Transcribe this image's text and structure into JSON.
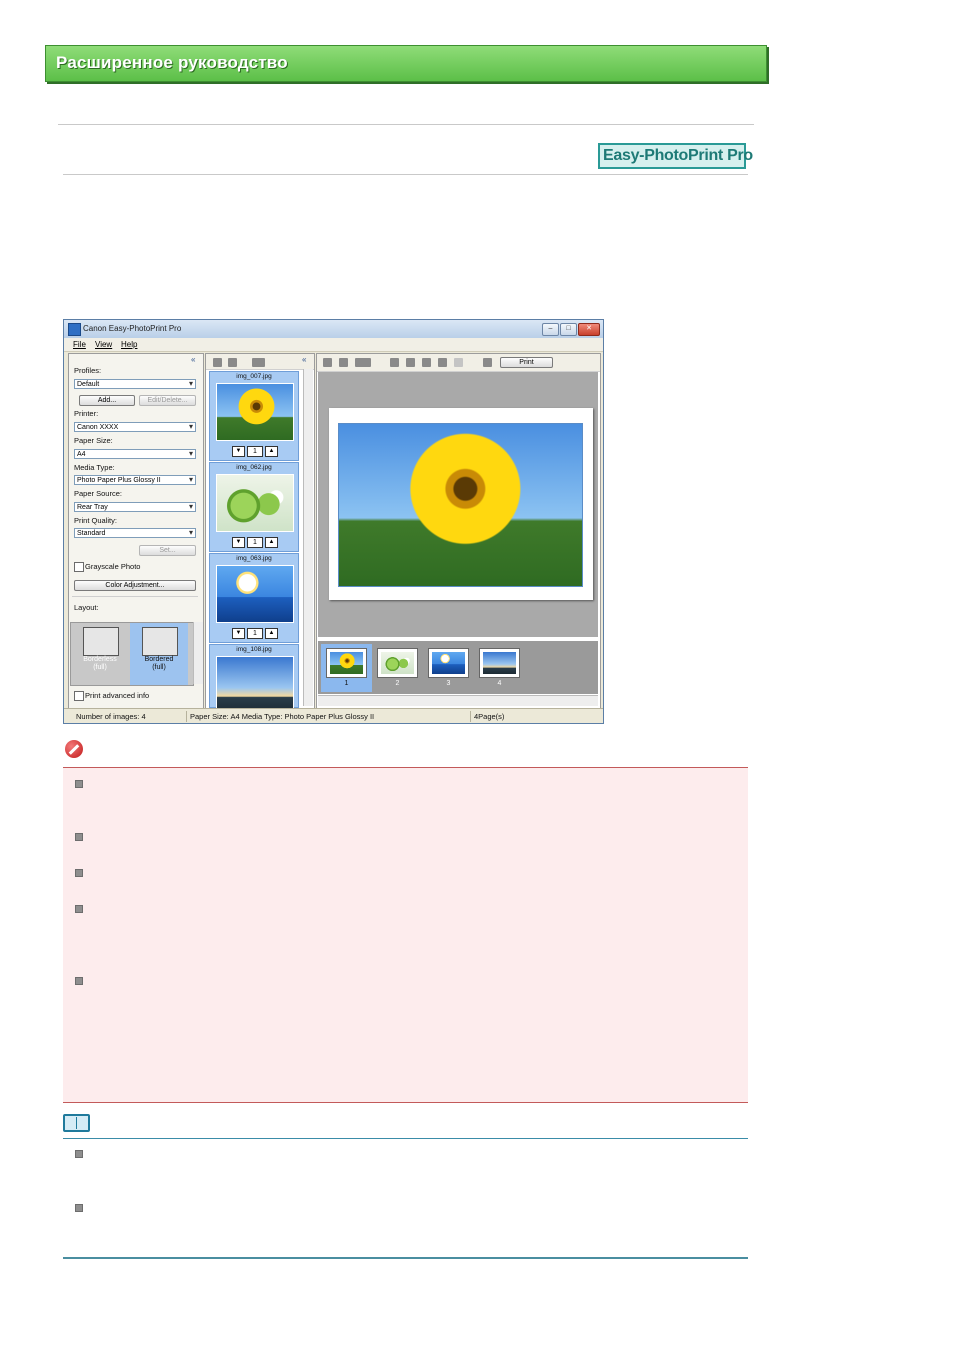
{
  "header": {
    "title": "Расширенное руководство"
  },
  "product_badge": "Easy-PhotoPrint Pro",
  "window": {
    "title": "Canon Easy-PhotoPrint Pro",
    "menu": [
      "File",
      "View",
      "Help"
    ],
    "left_panel": {
      "profiles_label": "Profiles:",
      "profiles_value": "Default",
      "add_button": "Add...",
      "edit_delete_button": "Edit/Delete...",
      "printer_label": "Printer:",
      "printer_value": "Canon XXXX",
      "paper_size_label": "Paper Size:",
      "paper_size_value": "A4",
      "media_type_label": "Media Type:",
      "media_type_value": "Photo Paper Plus Glossy II",
      "paper_source_label": "Paper Source:",
      "paper_source_value": "Rear Tray",
      "print_quality_label": "Print Quality:",
      "print_quality_value": "Standard",
      "set_button": "Set...",
      "grayscale_label": "Grayscale Photo",
      "color_adjustment_button": "Color Adjustment...",
      "layout_label": "Layout:",
      "layouts": [
        {
          "line1": "Borderless",
          "line2": "(full)"
        },
        {
          "line1": "Bordered",
          "line2": "(full)"
        }
      ],
      "print_advanced_label": "Print advanced info"
    },
    "images": [
      {
        "name": "img_007.jpg",
        "count": "1"
      },
      {
        "name": "img_062.jpg",
        "count": "1"
      },
      {
        "name": "img_063.jpg",
        "count": "1"
      },
      {
        "name": "img_108.jpg"
      }
    ],
    "print_button": "Print",
    "pages": [
      "1",
      "2",
      "3",
      "4"
    ],
    "status": {
      "images": "Number of images: 4",
      "paper": "Paper Size: A4  Media Type: Photo Paper Plus Glossy II",
      "pages": "4Page(s)"
    }
  },
  "colors": {
    "banner": "#6fcf58",
    "badge_border": "#2a9a96",
    "important_bg": "#fdeced",
    "note_line": "#3a8ca8"
  }
}
